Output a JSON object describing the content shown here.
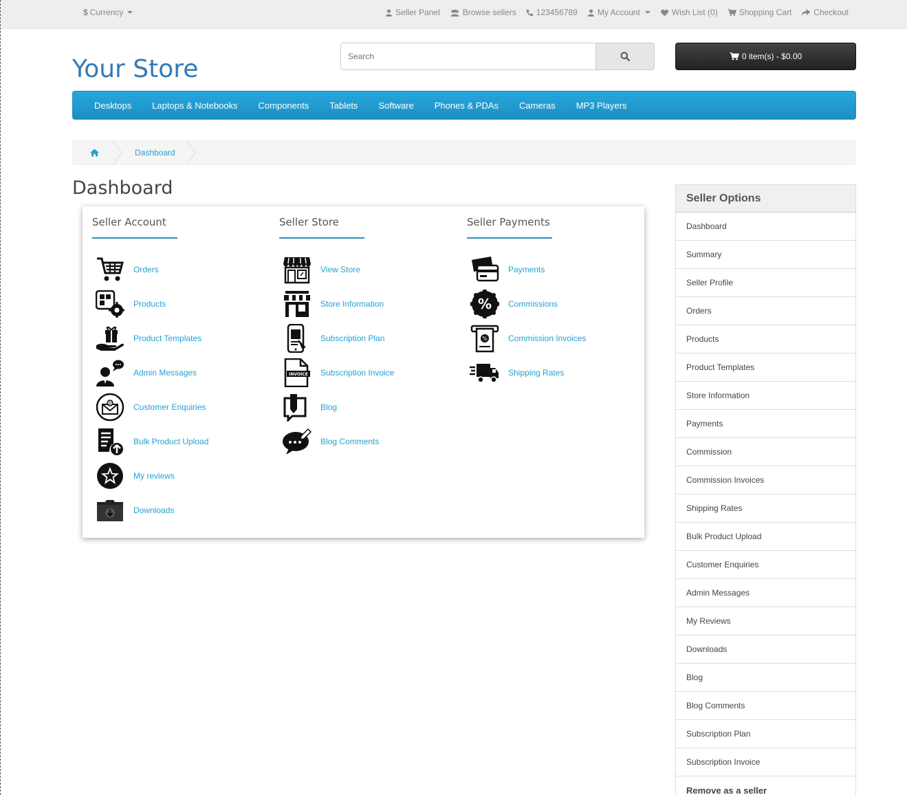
{
  "topbar": {
    "currency": "Currency",
    "links": [
      {
        "icon": "user-icon",
        "label": "Seller Panel"
      },
      {
        "icon": "users-icon",
        "label": "Browse sellers"
      },
      {
        "icon": "phone-icon",
        "label": "123456789"
      },
      {
        "icon": "user-icon",
        "label": "My Account"
      },
      {
        "icon": "heart-icon",
        "label": "Wish List (0)"
      },
      {
        "icon": "cart-icon",
        "label": "Shopping Cart"
      },
      {
        "icon": "share-icon",
        "label": "Checkout"
      }
    ]
  },
  "header": {
    "logo": "Your Store",
    "search_placeholder": "Search",
    "cart_label": "0 item(s) - $0.00"
  },
  "menu": [
    "Desktops",
    "Laptops & Notebooks",
    "Components",
    "Tablets",
    "Software",
    "Phones & PDAs",
    "Cameras",
    "MP3 Players"
  ],
  "breadcrumb": {
    "current": "Dashboard"
  },
  "page_title": "Dashboard",
  "dashboard": {
    "columns": [
      {
        "title": "Seller Account",
        "items": [
          {
            "label": "Orders",
            "icon": "shopping-cart-icon"
          },
          {
            "label": "Products",
            "icon": "products-gear-icon"
          },
          {
            "label": "Product Templates",
            "icon": "gift-hand-icon"
          },
          {
            "label": "Admin Messages",
            "icon": "admin-chat-icon"
          },
          {
            "label": "Customer Enquiries",
            "icon": "envelope-circle-icon"
          },
          {
            "label": "Bulk Product Upload",
            "icon": "upload-list-icon"
          },
          {
            "label": "My reviews",
            "icon": "star-badge-icon"
          },
          {
            "label": "Downloads",
            "icon": "download-folder-icon"
          }
        ]
      },
      {
        "title": "Seller Store",
        "items": [
          {
            "label": "View Store",
            "icon": "storefront-icon"
          },
          {
            "label": "Store Information",
            "icon": "store-info-icon"
          },
          {
            "label": "Subscription Plan",
            "icon": "mobile-plan-icon"
          },
          {
            "label": "Subscription Invoice",
            "icon": "invoice-icon"
          },
          {
            "label": "Blog",
            "icon": "blog-icon"
          },
          {
            "label": "Blog Comments",
            "icon": "comment-bubble-icon"
          }
        ]
      },
      {
        "title": "Seller Payments",
        "items": [
          {
            "label": "Payments",
            "icon": "credit-card-icon"
          },
          {
            "label": "Commissions",
            "icon": "percent-badge-icon"
          },
          {
            "label": "Commission Invoices",
            "icon": "receipt-percent-icon"
          },
          {
            "label": "Shipping Rates",
            "icon": "truck-icon"
          }
        ]
      }
    ]
  },
  "sidebar": {
    "title": "Seller Options",
    "items": [
      "Dashboard",
      "Summary",
      "Seller Profile",
      "Orders",
      "Products",
      "Product Templates",
      "Store Information",
      "Payments",
      "Commission",
      "Commission Invoices",
      "Shipping Rates",
      "Bulk Product Upload",
      "Customer Enquiries",
      "Admin Messages",
      "My Reviews",
      "Downloads",
      "Blog",
      "Blog Comments",
      "Subscription Plan",
      "Subscription Invoice"
    ],
    "remove_label": "Remove as a seller"
  }
}
